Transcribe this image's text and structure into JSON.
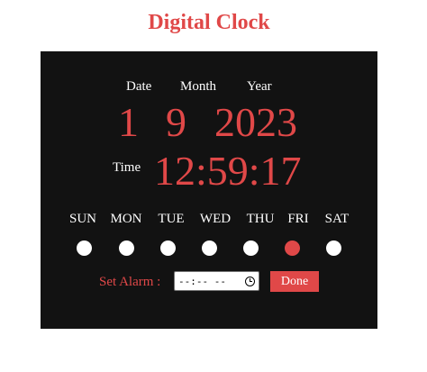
{
  "title": "Digital Clock",
  "date_labels": {
    "date": "Date",
    "month": "Month",
    "year": "Year"
  },
  "date_values": {
    "date": "1",
    "month": "9",
    "year": "2023"
  },
  "time": {
    "label": "Time",
    "value": "12:59:17"
  },
  "days": [
    {
      "label": "SUN",
      "active": false
    },
    {
      "label": "MON",
      "active": false
    },
    {
      "label": "TUE",
      "active": false
    },
    {
      "label": "WED",
      "active": false
    },
    {
      "label": "THU",
      "active": false
    },
    {
      "label": "FRI",
      "active": true
    },
    {
      "label": "SAT",
      "active": false
    }
  ],
  "alarm": {
    "label": "Set Alarm :",
    "input_value": "--:-- --",
    "done_label": "Done"
  },
  "colors": {
    "accent": "#e04848",
    "panel": "#121212",
    "inactive_dot": "#ffffff"
  }
}
